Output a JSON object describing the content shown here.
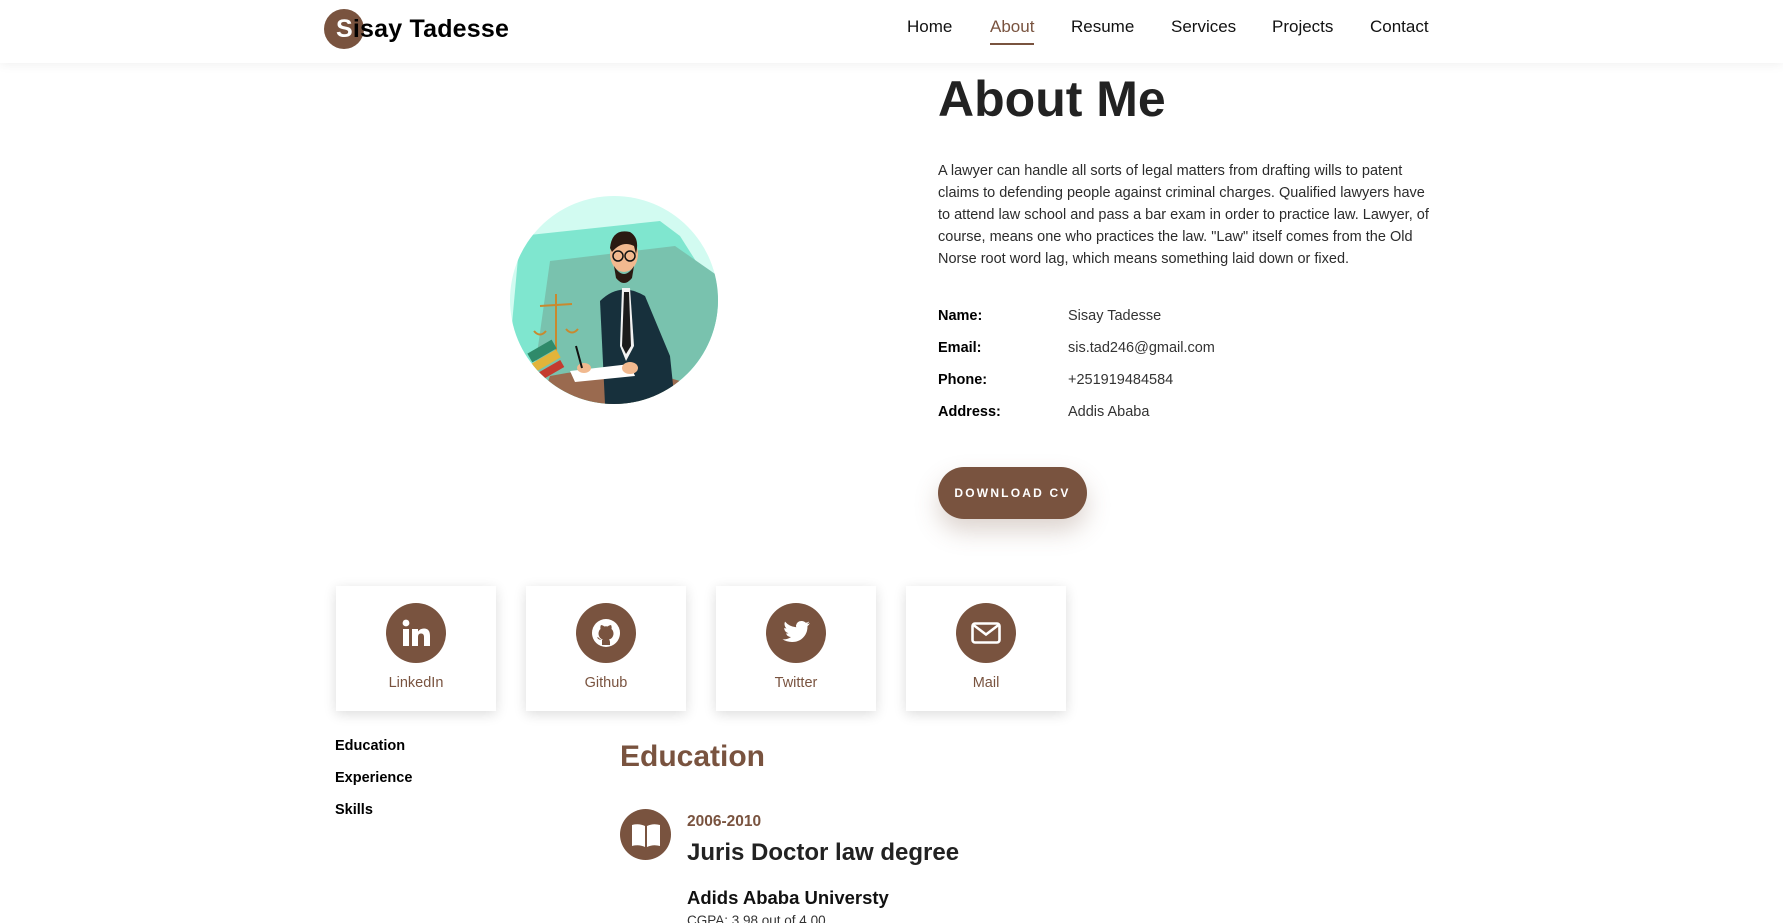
{
  "header": {
    "logo_initial": "S",
    "logo_rest": "isay Tadesse",
    "nav": [
      "Home",
      "About",
      "Resume",
      "Services",
      "Projects",
      "Contact"
    ],
    "active_nav": "About"
  },
  "about": {
    "title": "About Me",
    "description": "A lawyer can handle all sorts of legal matters from drafting wills to patent claims to defending people against criminal charges. Qualified lawyers have to attend law school and pass a bar exam in order to practice law. Lawyer, of course, means one who practices the law. \"Law\" itself comes from the Old Norse root word lag, which means something laid down or fixed.",
    "info": [
      {
        "label": "Name:",
        "value": "Sisay Tadesse"
      },
      {
        "label": "Email:",
        "value": "sis.tad246@gmail.com"
      },
      {
        "label": "Phone:",
        "value": "+251919484584"
      },
      {
        "label": "Address:",
        "value": "Addis Ababa"
      }
    ],
    "cv_button": "DOWNLOAD CV"
  },
  "social": [
    {
      "label": "LinkedIn",
      "icon": "linkedin-icon"
    },
    {
      "label": "Github",
      "icon": "github-icon"
    },
    {
      "label": "Twitter",
      "icon": "twitter-icon"
    },
    {
      "label": "Mail",
      "icon": "mail-icon"
    }
  ],
  "resume_tabs": [
    "Education",
    "Experience",
    "Skills"
  ],
  "education": {
    "heading": "Education",
    "icon": "book-icon",
    "entries": [
      {
        "date": "2006-2010",
        "title": "Juris Doctor law degree",
        "school": "Adids Ababa Universty",
        "cgpa": "CGPA: 3.98 out of 4.00"
      }
    ]
  },
  "colors": {
    "accent": "#79533f",
    "text": "#1f1f1f",
    "background": "#ffffff"
  }
}
